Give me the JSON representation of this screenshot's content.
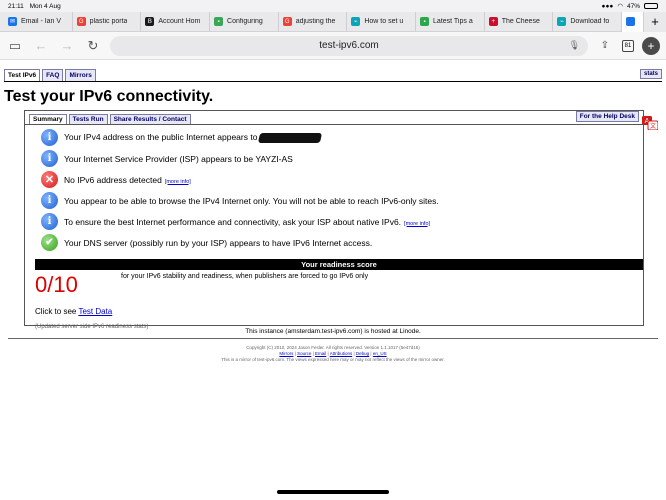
{
  "status_bar": {
    "time": "21:11",
    "date": "Mon 4 Aug",
    "battery": "47%"
  },
  "browser": {
    "tabs": [
      {
        "label": "Email - Ian V",
        "favicon_color": "#1a73e8",
        "favicon_glyph": "✉"
      },
      {
        "label": "plastic porta",
        "favicon_color": "#ea4335",
        "favicon_glyph": "G"
      },
      {
        "label": "Account Hom",
        "favicon_color": "#1b1b1b",
        "favicon_glyph": "B"
      },
      {
        "label": "Configuring",
        "favicon_color": "#3aa757",
        "favicon_glyph": "▪"
      },
      {
        "label": "adjusting the",
        "favicon_color": "#ea4335",
        "favicon_glyph": "G"
      },
      {
        "label": "How to set u",
        "favicon_color": "#0ba5b5",
        "favicon_glyph": "⌁"
      },
      {
        "label": "Latest Tips a",
        "favicon_color": "#2aa84a",
        "favicon_glyph": "▪"
      },
      {
        "label": "The Cheese",
        "favicon_color": "#c8102e",
        "favicon_glyph": "+"
      },
      {
        "label": "Download fo",
        "favicon_color": "#0ba5b5",
        "favicon_glyph": "⌁"
      }
    ],
    "active_tab_favicon_color": "#1a73e8",
    "url": "test-ipv6.com",
    "tab_count": "81"
  },
  "site": {
    "nav_tabs": [
      "Test IPv6",
      "FAQ",
      "Mirrors"
    ],
    "stats_label": "stats",
    "title": "Test your IPv6 connectivity.",
    "panel_tabs": [
      "Summary",
      "Tests Run",
      "Share Results / Contact"
    ],
    "help_desk": "For the Help Desk",
    "results": [
      {
        "type": "info",
        "text": "Your IPv4 address on the public Internet appears to",
        "redacted": true,
        "more": ""
      },
      {
        "type": "info",
        "text": "Your Internet Service Provider (ISP) appears to be YAYZI-AS",
        "redacted": false,
        "more": ""
      },
      {
        "type": "error",
        "text": "No IPv6 address detected",
        "redacted": false,
        "more": "[more info]"
      },
      {
        "type": "info",
        "text": "You appear to be able to browse the IPv4 Internet only. You will not be able to reach IPv6-only sites.",
        "redacted": false,
        "more": ""
      },
      {
        "type": "info",
        "text": "To ensure the best Internet performance and connectivity, ask your ISP about native IPv6.",
        "redacted": false,
        "more": "[more info]"
      },
      {
        "type": "ok",
        "text": "Your DNS server (possibly run by your ISP) appears to have IPv6 Internet access.",
        "redacted": false,
        "more": ""
      }
    ],
    "score_header": "Your readiness score",
    "score": "0/10",
    "score_desc": "for your IPv6 stability and readiness, when publishers are forced to go IPv6 only",
    "test_data_prefix": "Click to see",
    "test_data_link": "Test Data",
    "updated_note": "(Updated server side IPv6 readiness stats)",
    "hosted_note": "This instance (amsterdam.test-ipv6.com) is hosted at Linode.",
    "footer": {
      "copyright": "Copyright (C) 2010, 2024 Jason Fesler. All rights reserved. Version 1.1.1017 (5e47d16)",
      "links": [
        "Mirrors",
        "Source",
        "Email",
        "Attributions",
        "Debug",
        "en_US"
      ],
      "mirror_note": "This is a mirror of test-ipv6.com. The views expressed here may or may not reflect the views of the mirror owner."
    },
    "colors": {
      "link": "#0000cc",
      "score": "#e00000",
      "info": "#1f5fcf",
      "error": "#d01818",
      "ok": "#34a31c"
    }
  }
}
